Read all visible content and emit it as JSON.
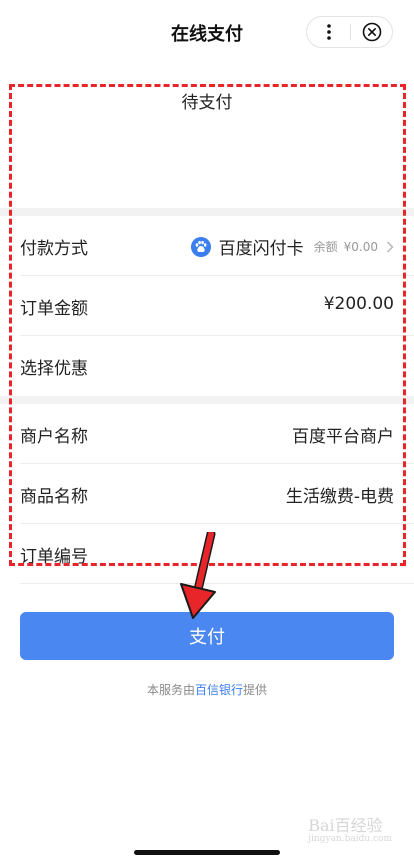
{
  "header": {
    "title": "在线支付",
    "more_icon": "more-vertical-icon",
    "close_icon": "close-circle-icon"
  },
  "status": {
    "text": "待支付"
  },
  "payment_rows": [
    {
      "label": "付款方式",
      "method_icon": "baidu-paw-icon",
      "method_name": "百度闪付卡",
      "balance_label": "余额",
      "balance_value": "¥0.00"
    },
    {
      "label": "订单金额",
      "value": "¥200.00"
    },
    {
      "label": "选择优惠",
      "value": ""
    }
  ],
  "merchant_rows": [
    {
      "label": "商户名称",
      "value": "百度平台商户"
    },
    {
      "label": "商品名称",
      "value": "生活缴费-电费"
    },
    {
      "label": "订单编号",
      "value": ""
    }
  ],
  "pay_button": {
    "label": "支付"
  },
  "footer": {
    "prefix": "本服务由",
    "bank": "百信银行",
    "suffix": "提供"
  },
  "watermark": {
    "text": "Bai百经验",
    "sub": "jingyan.baidu.com"
  },
  "colors": {
    "accent": "#4a87f0",
    "annotation": "#e8262a",
    "background": "#ffffff",
    "separator": "#f2f2f2"
  }
}
